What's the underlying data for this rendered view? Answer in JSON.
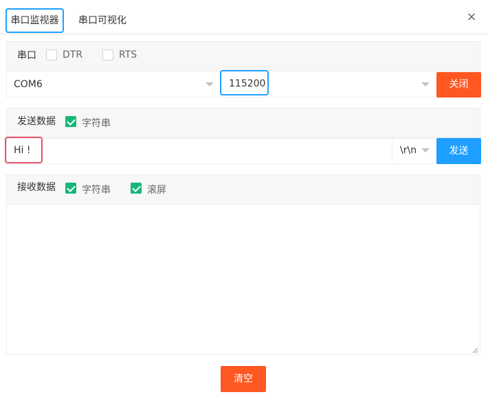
{
  "tabs": [
    {
      "label": "串口监视器"
    },
    {
      "label": "串口可视化"
    }
  ],
  "close_icon": "×",
  "serial": {
    "section_label": "串口",
    "dtr_label": "DTR",
    "rts_label": "RTS",
    "port_value": "COM6",
    "baud_value": "115200",
    "close_button": "关闭"
  },
  "send": {
    "section_label": "发送数据",
    "string_label": "字符串",
    "string_checked": true,
    "input_value": "Hi !",
    "line_ending": "\\r\\n",
    "send_button": "发送"
  },
  "receive": {
    "section_label": "接收数据",
    "string_label": "字符串",
    "string_checked": true,
    "scroll_label": "滚屏",
    "scroll_checked": true,
    "content": ""
  },
  "clear_button": "清空",
  "colors": {
    "accent_blue": "#1e9fff",
    "accent_orange": "#ff5722",
    "check_green": "#16b777",
    "highlight_red": "#e5546a"
  }
}
